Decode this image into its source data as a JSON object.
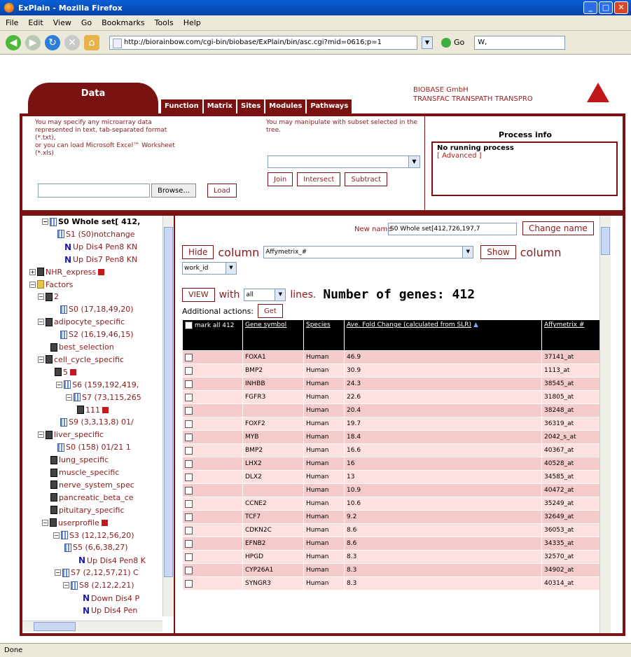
{
  "window": {
    "title": "ExPlain - Mozilla Firefox"
  },
  "menu": [
    "File",
    "Edit",
    "View",
    "Go",
    "Bookmarks",
    "Tools",
    "Help"
  ],
  "nav": {
    "url": "http://biorainbow.com/cgi-bin/biobase/ExPlain/bin/asc.cgi?mid=0616;p=1",
    "go_label": "Go",
    "search_value": "W,"
  },
  "header": {
    "data_tab": "Data",
    "tabs": [
      "Function",
      "Matrix",
      "Sites",
      "Modules",
      "Pathways"
    ],
    "company_line1": "BIOBASE GmbH",
    "company_line2": "TRANSFAC TRANSPATH TRANSPRO"
  },
  "upload": {
    "text": "You may specify any microarray data\nrepresented in text, tab-separated format\n(*.txt),\nor you can load Microsoft Excel™ Worksheet\n(*.xls)",
    "browse_label": "Browse...",
    "load_label": "Load"
  },
  "subset": {
    "text": "You may manipulate with subset selected in the tree.",
    "join_label": "Join",
    "intersect_label": "Intersect",
    "subtract_label": "Subtract"
  },
  "process": {
    "title": "Process info",
    "status": "No running process",
    "advanced": "[ Advanced ]"
  },
  "tree": [
    {
      "label": "S0 Whole set[ 412,",
      "icon": "set",
      "twisty": "−",
      "bold": true
    },
    {
      "label": "S1 (S0)notchange",
      "icon": "set",
      "twisty": ""
    },
    {
      "label": "Up Dis4 Pen8 KN",
      "icon": "N",
      "twisty": ""
    },
    {
      "label": "Up Dis7 Pen8 KN",
      "icon": "N",
      "twisty": ""
    },
    {
      "label": "NHR_express",
      "icon": "fam",
      "twisty": "+",
      "red": true
    },
    {
      "label": "Factors",
      "icon": "folder",
      "twisty": "−"
    },
    {
      "label": "2",
      "icon": "fam",
      "twisty": "−"
    },
    {
      "label": "S0 (17,18,49,20)",
      "icon": "set",
      "twisty": ""
    },
    {
      "label": "adipocyte_specific",
      "icon": "fam",
      "twisty": "−"
    },
    {
      "label": "S2 (16,19,46,15)",
      "icon": "set",
      "twisty": ""
    },
    {
      "label": "best_selection",
      "icon": "fam",
      "twisty": ""
    },
    {
      "label": "cell_cycle_specific",
      "icon": "fam",
      "twisty": "−"
    },
    {
      "label": "5",
      "icon": "fam",
      "twisty": "",
      "red": true
    },
    {
      "label": "S6 (159,192,419,",
      "icon": "set",
      "twisty": "−"
    },
    {
      "label": "S7 (73,115,265",
      "icon": "set",
      "twisty": "−"
    },
    {
      "label": "111",
      "icon": "fam",
      "twisty": "",
      "red": true
    },
    {
      "label": "S9 (3,3,13,8) 01/",
      "icon": "set",
      "twisty": ""
    },
    {
      "label": "liver_specific",
      "icon": "fam",
      "twisty": "−"
    },
    {
      "label": "S0 (158) 01/21 1",
      "icon": "set",
      "twisty": ""
    },
    {
      "label": "lung_specific",
      "icon": "fam",
      "twisty": ""
    },
    {
      "label": "muscle_specific",
      "icon": "fam",
      "twisty": ""
    },
    {
      "label": "nerve_system_spec",
      "icon": "fam",
      "twisty": ""
    },
    {
      "label": "pancreatic_beta_ce",
      "icon": "fam",
      "twisty": ""
    },
    {
      "label": "pituitary_specific",
      "icon": "fam",
      "twisty": ""
    },
    {
      "label": "userprofile",
      "icon": "fam",
      "twisty": "−",
      "red": true
    },
    {
      "label": "S3 (12,12,56,20)",
      "icon": "set",
      "twisty": "−"
    },
    {
      "label": "S5 (6,6,38,27)",
      "icon": "set",
      "twisty": ""
    },
    {
      "label": "Up Dis4 Pen8 K",
      "icon": "N",
      "twisty": ""
    },
    {
      "label": "S7 (2,12,57,21) C",
      "icon": "set",
      "twisty": "−"
    },
    {
      "label": "S8 (2,12,2,21)",
      "icon": "set",
      "twisty": "−"
    },
    {
      "label": "Down Dis4 P",
      "icon": "N",
      "twisty": ""
    },
    {
      "label": "Up Dis4 Pen",
      "icon": "N",
      "twisty": ""
    }
  ],
  "controls": {
    "new_name_label": "New name",
    "new_name_value": "S0 Whole set[412,726,197,7",
    "change_name": "Change name",
    "hide": "Hide",
    "column_word": "column",
    "hide_select": "Affymetrix_#",
    "show": "Show",
    "column_word2": "column",
    "workid_select": "work_id",
    "view": "VIEW",
    "with": "with",
    "lines_select": "all",
    "lines": "lines.",
    "number_of_genes": "Number of genes: 412",
    "additional_actions": "Additional actions:",
    "get": "Get"
  },
  "table": {
    "headers": {
      "mark": "mark all 412",
      "gene": "Gene symbol",
      "species": "Species",
      "fold": "Ave. Fold Change (calculated from SLR)",
      "affy": "Affymetrix #"
    },
    "rows": [
      {
        "gene": "FOXA1",
        "species": "Human",
        "fold": "46.9",
        "affy": "37141_at"
      },
      {
        "gene": "BMP2",
        "species": "Human",
        "fold": "30.9",
        "affy": "1113_at"
      },
      {
        "gene": "INHBB",
        "species": "Human",
        "fold": "24.3",
        "affy": "38545_at"
      },
      {
        "gene": "FGFR3",
        "species": "Human",
        "fold": "22.6",
        "affy": "31805_at"
      },
      {
        "gene": "",
        "species": "Human",
        "fold": "20.4",
        "affy": "38248_at"
      },
      {
        "gene": "FOXF2",
        "species": "Human",
        "fold": "19.7",
        "affy": "36319_at"
      },
      {
        "gene": "MYB",
        "species": "Human",
        "fold": "18.4",
        "affy": "2042_s_at"
      },
      {
        "gene": "BMP2",
        "species": "Human",
        "fold": "16.6",
        "affy": "40367_at"
      },
      {
        "gene": "LHX2",
        "species": "Human",
        "fold": "16",
        "affy": "40528_at"
      },
      {
        "gene": "DLX2",
        "species": "Human",
        "fold": "13",
        "affy": "34585_at"
      },
      {
        "gene": "",
        "species": "Human",
        "fold": "10.9",
        "affy": "40472_at"
      },
      {
        "gene": "CCNE2",
        "species": "Human",
        "fold": "10.6",
        "affy": "35249_at"
      },
      {
        "gene": "TCF7",
        "species": "Human",
        "fold": "9.2",
        "affy": "32649_at"
      },
      {
        "gene": "CDKN2C",
        "species": "Human",
        "fold": "8.6",
        "affy": "36053_at"
      },
      {
        "gene": "EFNB2",
        "species": "Human",
        "fold": "8.6",
        "affy": "34335_at"
      },
      {
        "gene": "HPGD",
        "species": "Human",
        "fold": "8.3",
        "affy": "32570_at"
      },
      {
        "gene": "CYP26A1",
        "species": "Human",
        "fold": "8.3",
        "affy": "34902_at"
      },
      {
        "gene": "SYNGR3",
        "species": "Human",
        "fold": "8.3",
        "affy": "40314_at"
      }
    ]
  },
  "status": "Done"
}
